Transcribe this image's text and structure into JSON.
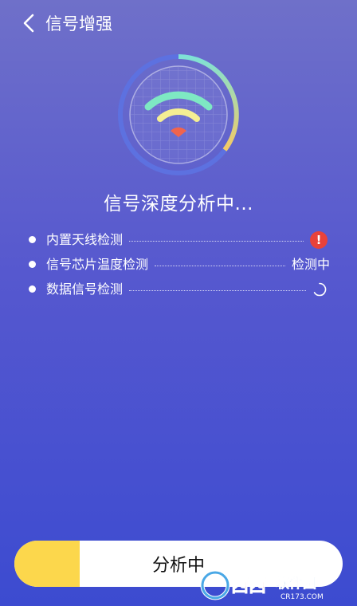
{
  "header": {
    "title": "信号增强",
    "back_icon": "chevron-left-icon"
  },
  "gauge": {
    "icon": "wifi-icon",
    "colors": {
      "wifi_outer": "#7ee8c3",
      "wifi_middle": "#f4ee93",
      "wifi_dot": "#f0644e",
      "ring_track": "#5d71e0",
      "ring_progress_start": "#7ee2d6",
      "ring_progress_end": "#f5c964"
    }
  },
  "status_text": "信号深度分析中...",
  "checks": [
    {
      "label": "内置天线检测",
      "status_text": "",
      "status_icon": "warning-icon"
    },
    {
      "label": "信号芯片温度检测",
      "status_text": "检测中",
      "status_icon": ""
    },
    {
      "label": "数据信号检测",
      "status_text": "",
      "status_icon": "spinner-icon"
    }
  ],
  "bottom_button": {
    "label": "分析中",
    "progress": 0.2,
    "fill_color": "#fcd74c"
  },
  "watermark": {
    "text": "西西软件园",
    "url_text": "CR173.COM"
  }
}
